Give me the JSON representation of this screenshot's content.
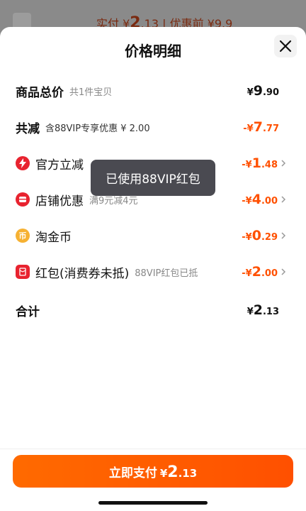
{
  "behind": {
    "text_prefix": "实付 ¥",
    "text_big": "2",
    "text_suffix": ".13 | 优惠前 ¥9.9"
  },
  "sheet": {
    "title": "价格明细",
    "close_icon": "close-icon"
  },
  "rows": {
    "total_goods": {
      "label": "商品总价",
      "sub": "共1件宝贝",
      "sym": "¥",
      "int": "9",
      "dec": ".90"
    },
    "discount_total": {
      "label": "共减",
      "sub": "含88VIP专享优惠 ¥ 2.00",
      "sym": "-¥",
      "int": "7",
      "dec": ".77"
    },
    "official": {
      "label": "官方立减",
      "sym": "-¥",
      "int": "1",
      "dec": ".48",
      "icon": "lightning-icon"
    },
    "shop": {
      "label": "店铺优惠",
      "sub": "满9元减4元",
      "sym": "-¥",
      "int": "4",
      "dec": ".00",
      "icon": "shop-coupon-icon"
    },
    "taojinbi": {
      "label": "淘金币",
      "sym": "-¥",
      "int": "0",
      "dec": ".29",
      "icon": "coin-icon",
      "icon_glyph": "币"
    },
    "hongbao": {
      "label": "红包(消费券未抵)",
      "sub": "88VIP红包已抵",
      "sym": "-¥",
      "int": "2",
      "dec": ".00",
      "icon": "red-packet-icon"
    },
    "sum": {
      "label": "合计",
      "sym": "¥",
      "int": "2",
      "dec": ".13"
    }
  },
  "toast": {
    "text": "已使用88VIP红包"
  },
  "pay_button": {
    "label": "立即支付",
    "sym": "¥",
    "int": "2",
    "dec": ".13"
  },
  "colors": {
    "accent": "#ff5000",
    "icon_red": "#e8232f",
    "icon_gold": "#f6b132"
  }
}
